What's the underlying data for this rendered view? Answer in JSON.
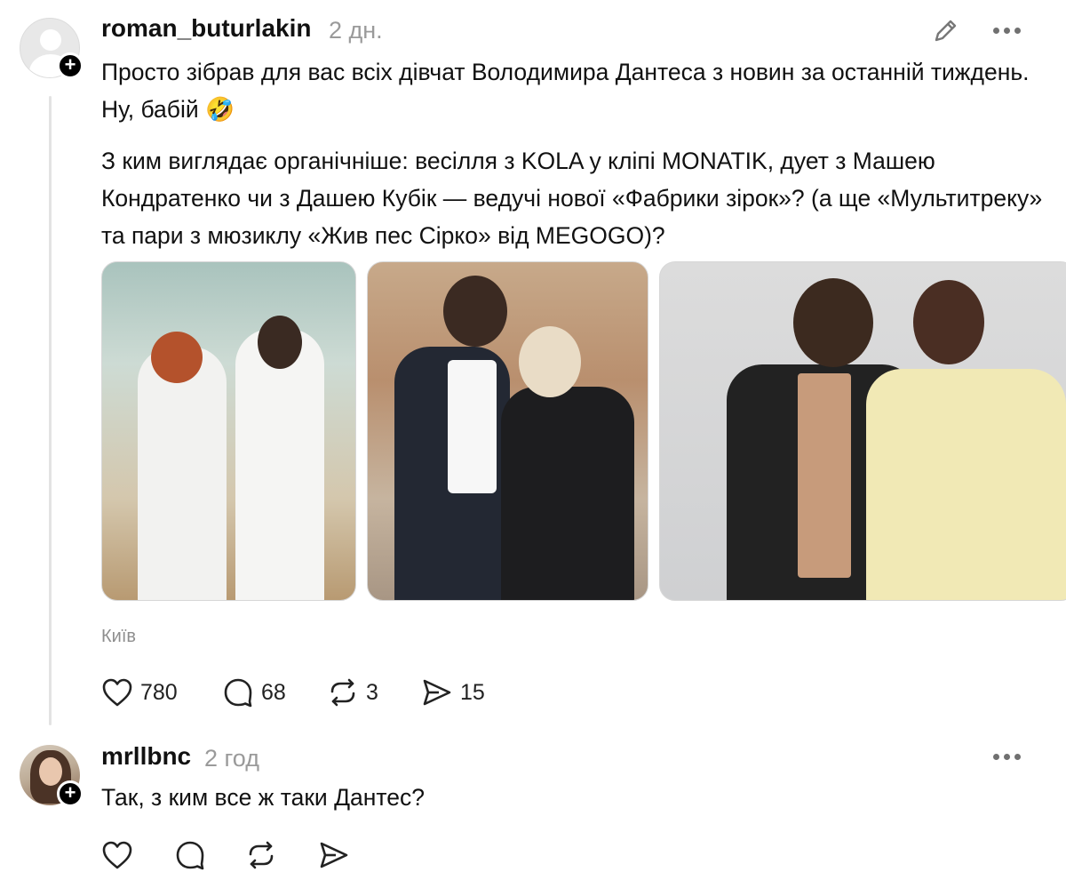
{
  "post": {
    "username": "roman_buturlakin",
    "time": "2 дн.",
    "paragraph1": "Просто зібрав для вас всіх дівчат Володимира Дантеса з новин за останній тиждень. Ну, бабій 🤣",
    "paragraph2": "З ким виглядає органічніше: весілля з KOLA у кліпі MONATIK, дует з Машею Кондратенко чи з Дашею Кубік — ведучі нової «Фабрики зірок»? (а ще «Мультитреку» та пари з мюзиклу «Жив пес Сірко» від MEGOGO)?",
    "location": "Київ",
    "actions": {
      "likes": "780",
      "comments": "68",
      "reposts": "3",
      "shares": "15"
    },
    "icons": {
      "edit": "pencil-icon",
      "more": "more-icon",
      "follow": "plus-icon"
    }
  },
  "reply": {
    "username": "mrllbnc",
    "time": "2 год",
    "text": "Так, з ким все ж таки Дантес?"
  }
}
